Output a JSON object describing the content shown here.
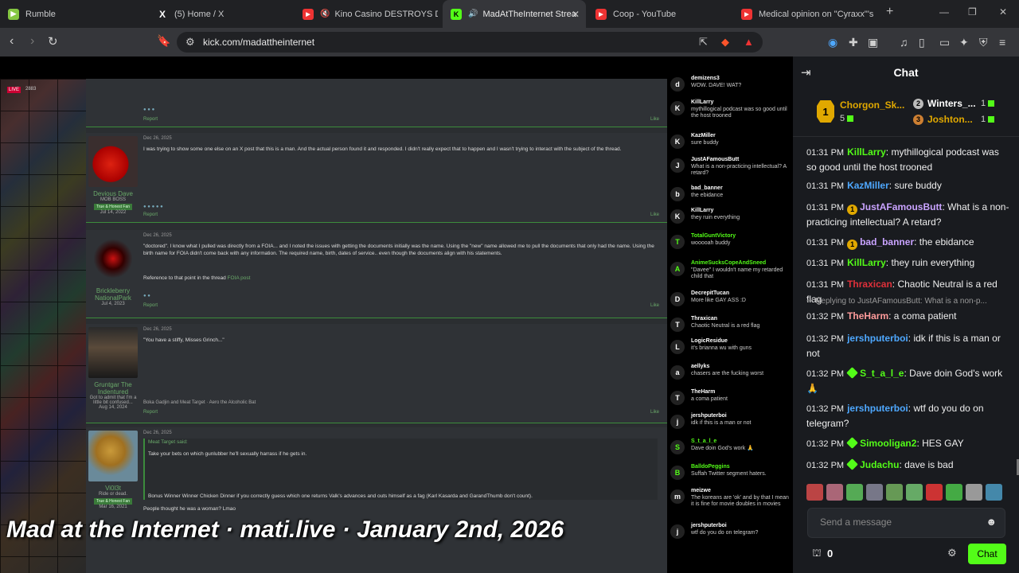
{
  "tabs": [
    {
      "title": "Rumble",
      "color": "#85c742",
      "glyph": "▶"
    },
    {
      "title": "(5) Home / X",
      "color": "#ffffff",
      "glyph": "X"
    },
    {
      "title": "Kino Casino DESTROYS DSP",
      "color": "#e33",
      "glyph": "▶"
    },
    {
      "title": "MadAtTheInternet Stream",
      "color": "#53fc18",
      "glyph": "K"
    },
    {
      "title": "Coop - YouTube",
      "color": "#e33",
      "glyph": "▶"
    },
    {
      "title": "Medical opinion on \"Cyraxx\"'s m",
      "color": "#e33",
      "glyph": "▶"
    }
  ],
  "address": {
    "url": "kick.com/madattheinternet"
  },
  "video": {
    "live_label": "LIVE",
    "viewers": "2883",
    "caption": "Mad at the Internet · mati.live · January 2nd, 2026",
    "posts": [
      {
        "date": "",
        "text": "",
        "user": "",
        "title": ""
      },
      {
        "date": "Dec 26, 2025",
        "text": "I was trying to show some one else on an X post that this is a man. And the actual person found it and responded. I didn't really expect that to happen and I wasn't trying to interact with the subject of the thread.",
        "user": "Devious Dave",
        "title": "MOB BOSS",
        "badge": "True & Honest Fan",
        "joined": "Jul 14, 2022"
      },
      {
        "date": "Dec 26, 2025",
        "text": "\"doctored\". I know what I pulled was directly from a FOIA... and I noted the issues with getting the documents initially was the name. Using the \"new\" name allowed me to pull the documents that only had the name. Using the birth name for FOIA didn't come back with any information. The required name, birth, dates of service.. even though the documents align with his statements.",
        "text2": "Reference to that point in the thread",
        "link": "FOIA post",
        "user": "Brickleberry NationalPark",
        "title": "",
        "joined": "Jul 4, 2023"
      },
      {
        "date": "Dec 26, 2025",
        "text": "\"You have a stiffy, Misses Grinch...\"",
        "user": "Gruntgar The Indentured",
        "title": "Got to admit that I'm a little bit confused...",
        "joined": "Aug 14, 2024",
        "reacts": "Boka Gadjin and Meat Target · Aero the Alcoholic Bat"
      },
      {
        "date": "Dec 26, 2025",
        "quote": "Meat Target said:",
        "text": "Take your bets on which gunlubber he'll sexually harrass if he gets in.",
        "text2": "Bonus Winner Winner Chicken Dinner if you correctly guess which one returns Valk's advances and outs himself as a fag (Karl Kasarda and GarandThumb don't count).",
        "text3": "People thought he was a woman? Lmao",
        "user": "Vi0l3t",
        "title": "Ride or dead.",
        "badge": "True & Honest Fan",
        "joined": "Mar 16, 2021"
      }
    ],
    "overlay_chat": [
      {
        "name": "demizens3",
        "text": "WOW. DAVE! WAT?",
        "av": "d",
        "color": "#fff"
      },
      {
        "name": "KillLarry",
        "text": "mythillogical podcast was so good until the host trooned",
        "av": "K",
        "color": "#fff"
      },
      {
        "name": "KazMiller",
        "text": "sure buddy",
        "av": "K",
        "color": "#fff"
      },
      {
        "name": "JustAFamousButt",
        "text": "What is a non-practicing intellectual? A retard?",
        "av": "J",
        "color": "#fff"
      },
      {
        "name": "bad_banner",
        "text": "the ebidance",
        "av": "b",
        "color": "#fff"
      },
      {
        "name": "KillLarry",
        "text": "they ruin everything",
        "av": "K",
        "color": "#fff"
      },
      {
        "name": "TotalGuntVictory",
        "text": "wooooah buddy",
        "av": "T",
        "color": "#53fc18"
      },
      {
        "name": "AnimeSucksCopeAndSneed",
        "text": "\"Davee\" I wouldn't name my retarded child that",
        "av": "A",
        "color": "#53fc18"
      },
      {
        "name": "DecrepitTucan",
        "text": "More like GAY ASS :D",
        "av": "D",
        "color": "#fff"
      },
      {
        "name": "Thraxican",
        "text": "Chaotic Neutral is a red flag",
        "av": "T",
        "color": "#fff"
      },
      {
        "name": "LogicResidue",
        "text": "it's brianna wu with guns",
        "av": "L",
        "color": "#fff"
      },
      {
        "name": "aellyks",
        "text": "chasers are the fucking worst",
        "av": "a",
        "color": "#fff"
      },
      {
        "name": "TheHarm",
        "text": "a coma patient",
        "av": "T",
        "color": "#fff"
      },
      {
        "name": "jershputerboi",
        "text": "idk if this is a man or not",
        "av": "j",
        "color": "#fff"
      },
      {
        "name": "S_t_a_l_e",
        "text": "Dave doin God's work 🙏",
        "av": "S",
        "color": "#53fc18"
      },
      {
        "name": "BalldoPeggins",
        "text": "Suffah Twitter segment haters.",
        "av": "B",
        "color": "#53fc18"
      },
      {
        "name": "meizwe",
        "text": "The koreans are 'ok' and by that I mean it is fine for movie doubles in movies",
        "av": "m",
        "color": "#fff"
      },
      {
        "name": "jershputerboi",
        "text": "wtf do you do on telegram?",
        "av": "j",
        "color": "#fff"
      }
    ]
  },
  "chat": {
    "title": "Chat",
    "leaderboard": {
      "first": {
        "rank": "1",
        "name": "Chorgon_Sk...",
        "count": "5"
      },
      "second": {
        "rank": "2",
        "name": "Winters_...",
        "count": "1"
      },
      "third": {
        "rank": "3",
        "name": "Joshton...",
        "count": "1"
      }
    },
    "messages": [
      {
        "time": "01:31 PM",
        "user": "KillLarry",
        "color": "#53fc18",
        "badge": "",
        "text": "mythillogical podcast was so good until the host trooned"
      },
      {
        "time": "01:31 PM",
        "user": "KazMiller",
        "color": "#4ea8ff",
        "badge": "",
        "text": "sure buddy"
      },
      {
        "time": "01:31 PM",
        "user": "JustAFamousButt",
        "color": "#c9a3ff",
        "badge": "1",
        "text": "What is a non-practicing intellectual? A retard?"
      },
      {
        "time": "01:31 PM",
        "user": "bad_banner",
        "color": "#c9a3ff",
        "badge": "1",
        "text": "the ebidance"
      },
      {
        "time": "01:31 PM",
        "user": "KillLarry",
        "color": "#53fc18",
        "badge": "",
        "text": "they ruin everything"
      },
      {
        "time": "01:31 PM",
        "user": "Thraxican",
        "color": "#e0303a",
        "badge": "",
        "text": "Chaotic Neutral is a red flag"
      },
      {
        "time": "01:32 PM",
        "user": "TheHarm",
        "color": "#ff9b9b",
        "badge": "",
        "text": "a coma patient"
      },
      {
        "time": "01:32 PM",
        "user": "jershputerboi",
        "color": "#4ea8ff",
        "badge": "",
        "text": "idk if this is a man or not"
      },
      {
        "time": "01:32 PM",
        "user": "S_t_a_l_e",
        "color": "#53fc18",
        "badge": "",
        "text": "Dave doin God's work 🙏"
      },
      {
        "time": "01:32 PM",
        "user": "jershputerboi",
        "color": "#4ea8ff",
        "badge": "",
        "text": "wtf do you do on telegram?"
      },
      {
        "time": "01:32 PM",
        "user": "Simooligan2",
        "color": "#53fc18",
        "badge": "",
        "text": "HES GAY"
      },
      {
        "time": "01:32 PM",
        "user": "Judachu",
        "color": "#53fc18",
        "badge": "",
        "text": "dave is bad"
      }
    ],
    "reply_label": "Replying to JustAFamousButt: What is a non-p...",
    "message_placeholder": "Send a message",
    "points": "0",
    "send_label": "Chat"
  }
}
